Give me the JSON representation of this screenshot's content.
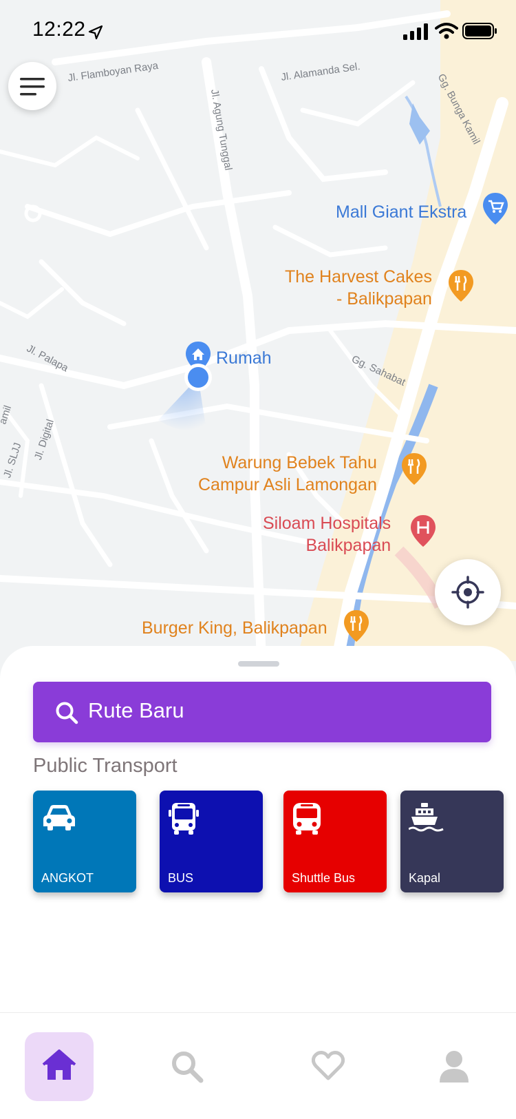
{
  "status_bar": {
    "time": "12:22"
  },
  "map": {
    "streets": [
      "Jl. Flamboyan Raya",
      "Jl. Alamanda Sel.",
      "Jl. Agung Tunggal",
      "Gg. Bunga Kamil",
      "Jl. Palapa",
      "Gg. Sahabat",
      "Jl. Digital",
      "Jl. SLJJ",
      "amil"
    ],
    "places": {
      "mall": "Mall Giant Ekstra",
      "harvest_line1": "The Harvest Cakes",
      "harvest_line2": "- Balikpapan",
      "warung_line1": "Warung Bebek Tahu",
      "warung_line2": "Campur Asli Lamongan",
      "siloam_line1": "Siloam Hospitals",
      "siloam_line2": "Balikpapan",
      "burger": "Burger King, Balikpapan",
      "home": "Rumah"
    },
    "colors": {
      "poi_food": "#e0821d",
      "poi_hospital": "#e0525c",
      "poi_shop": "#3b79d6",
      "home": "#4a8df0"
    }
  },
  "sheet": {
    "search_label": "Rute Baru",
    "section_title": "Public Transport",
    "transports": [
      {
        "label": "ANGKOT",
        "icon": "car-icon",
        "color": "#0077b8"
      },
      {
        "label": "BUS",
        "icon": "bus-icon",
        "color": "#0d10b0"
      },
      {
        "label": "Shuttle Bus",
        "icon": "shuttle-bus-icon",
        "color": "#e60000"
      },
      {
        "label": "Kapal",
        "icon": "ship-icon",
        "color": "#363758"
      }
    ],
    "accent": "#8a3cd8"
  },
  "bottom_nav": {
    "items": [
      {
        "icon": "home-icon",
        "active": true
      },
      {
        "icon": "search-icon",
        "active": false
      },
      {
        "icon": "heart-icon",
        "active": false
      },
      {
        "icon": "profile-icon",
        "active": false
      }
    ]
  }
}
